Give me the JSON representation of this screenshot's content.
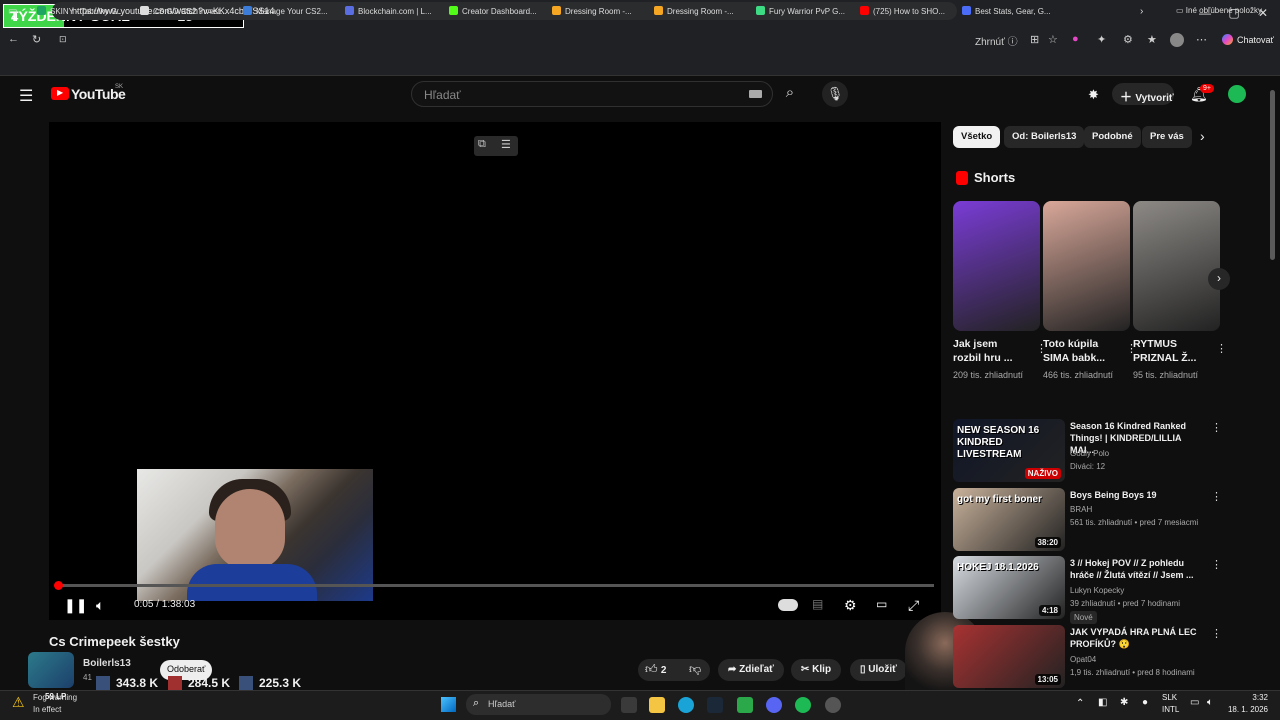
{
  "overlay_goal": {
    "left_value": "4",
    "label": "TÝŽDENNÝ GOAL",
    "plus": "+",
    "right_value": "15"
  },
  "window_controls": {
    "minimize": "—",
    "maximize": "▢",
    "close": "✕"
  },
  "browser": {
    "url": "https://www.youtube.com/watch?v=KKx4cbWSS14",
    "summarize_label": "Zhrnúť",
    "copilot_label": "Chatovať",
    "favorites_label": "Iné obľúbené položky",
    "bookmarks": [
      {
        "label": "SKINY - Tabuľky G...",
        "color": "#1fa463"
      },
      {
        "label": "CS:GO/CS2 Invest...",
        "color": "#dddddd"
      },
      {
        "label": "Manage Your CS2...",
        "color": "#3c7dd9"
      },
      {
        "label": "Blockchain.com | L...",
        "color": "#5b6ee1"
      },
      {
        "label": "Creator Dashboard...",
        "color": "#53fc18"
      },
      {
        "label": "Dressing Room -...",
        "color": "#f5a623"
      },
      {
        "label": "Dressing Room -...",
        "color": "#f5a623"
      },
      {
        "label": "Fury Warrior PvP G...",
        "color": "#3ddc84"
      },
      {
        "label": "(725) How to SHO...",
        "color": "#ff0000"
      },
      {
        "label": "Best Stats, Gear, G...",
        "color": "#4a6cf7"
      }
    ]
  },
  "youtube": {
    "logo_text": "YouTube",
    "region": "SK",
    "search_placeholder": "Hľadať",
    "create_label": "Vytvoriť",
    "notifications_badge": "9+"
  },
  "player": {
    "time": "0:05 / 1:38:03",
    "progress_fraction": 0.0009,
    "video_title": "Cs Crimepeek šestky",
    "channel_name": "Boilerls13",
    "subscribe_label": "Odoberať",
    "subscriber_prefix": "41",
    "likes": "2",
    "share_label": "Zdieľať",
    "clip_label": "Klip",
    "save_label": "Uložiť"
  },
  "stream_overlay": {
    "lp": "59 LP",
    "stats": [
      "343.8 K",
      "284.5 K",
      "225.3 K"
    ]
  },
  "filters": [
    "Všetko",
    "Od: Boilerls13",
    "Podobné",
    "Pre vás"
  ],
  "shorts": {
    "heading": "Shorts",
    "items": [
      {
        "title": "Jak jsem rozbil hru ...",
        "views": "209 tis. zhliadnutí",
        "color": "#7a3cd6"
      },
      {
        "title": "Toto kúpila SIMA babk...",
        "views": "466 tis. zhliadnutí",
        "color": "#d9a89a"
      },
      {
        "title": "RYTMUS PRIZNAL Ž...",
        "views": "95 tis. zhliadnutí",
        "color": "#8d8a86"
      }
    ]
  },
  "recommendations": [
    {
      "title": "Season 16 Kindred Ranked Things! | KINDRED/LILLIA MAI...",
      "channel": "Godly Polo",
      "meta": "Diváci: 12",
      "badge": "NAŽIVO",
      "thumb_text": "NEW SEASON 16 KINDRED LIVESTREAM",
      "color": "#101628"
    },
    {
      "title": "Boys Being Boys 19",
      "channel": "BRAH",
      "meta": "561 tis. zhliadnutí • pred 7 mesiacmi",
      "duration": "38:20",
      "thumb_text": "got my first boner",
      "color": "#c9b29b"
    },
    {
      "title": "3 // Hokej POV // Z pohledu hráče // Žlutá vítězí // Jsem ...",
      "channel": "Lukyn Kopecky",
      "meta": "39 zhliadnutí • pred 7 hodinami",
      "tag": "Nové",
      "duration": "4:18",
      "thumb_text": "HOKEJ 18.1.2026",
      "color": "#d8dde3"
    },
    {
      "title": "JAK VYPADÁ HRA PLNÁ LEC PROFÍKŮ? 😲",
      "channel": "Opat04",
      "meta": "1,9 tis. zhliadnutí • pred 8 hodinami",
      "duration": "13:05",
      "color": "#a83232"
    }
  ],
  "taskbar": {
    "notification_title": "Fog warning",
    "notification_sub": "In effect",
    "search_placeholder": "Hľadať",
    "language": "SLK",
    "layout": "INTL",
    "time": "3:32",
    "date": "18. 1. 2026"
  }
}
